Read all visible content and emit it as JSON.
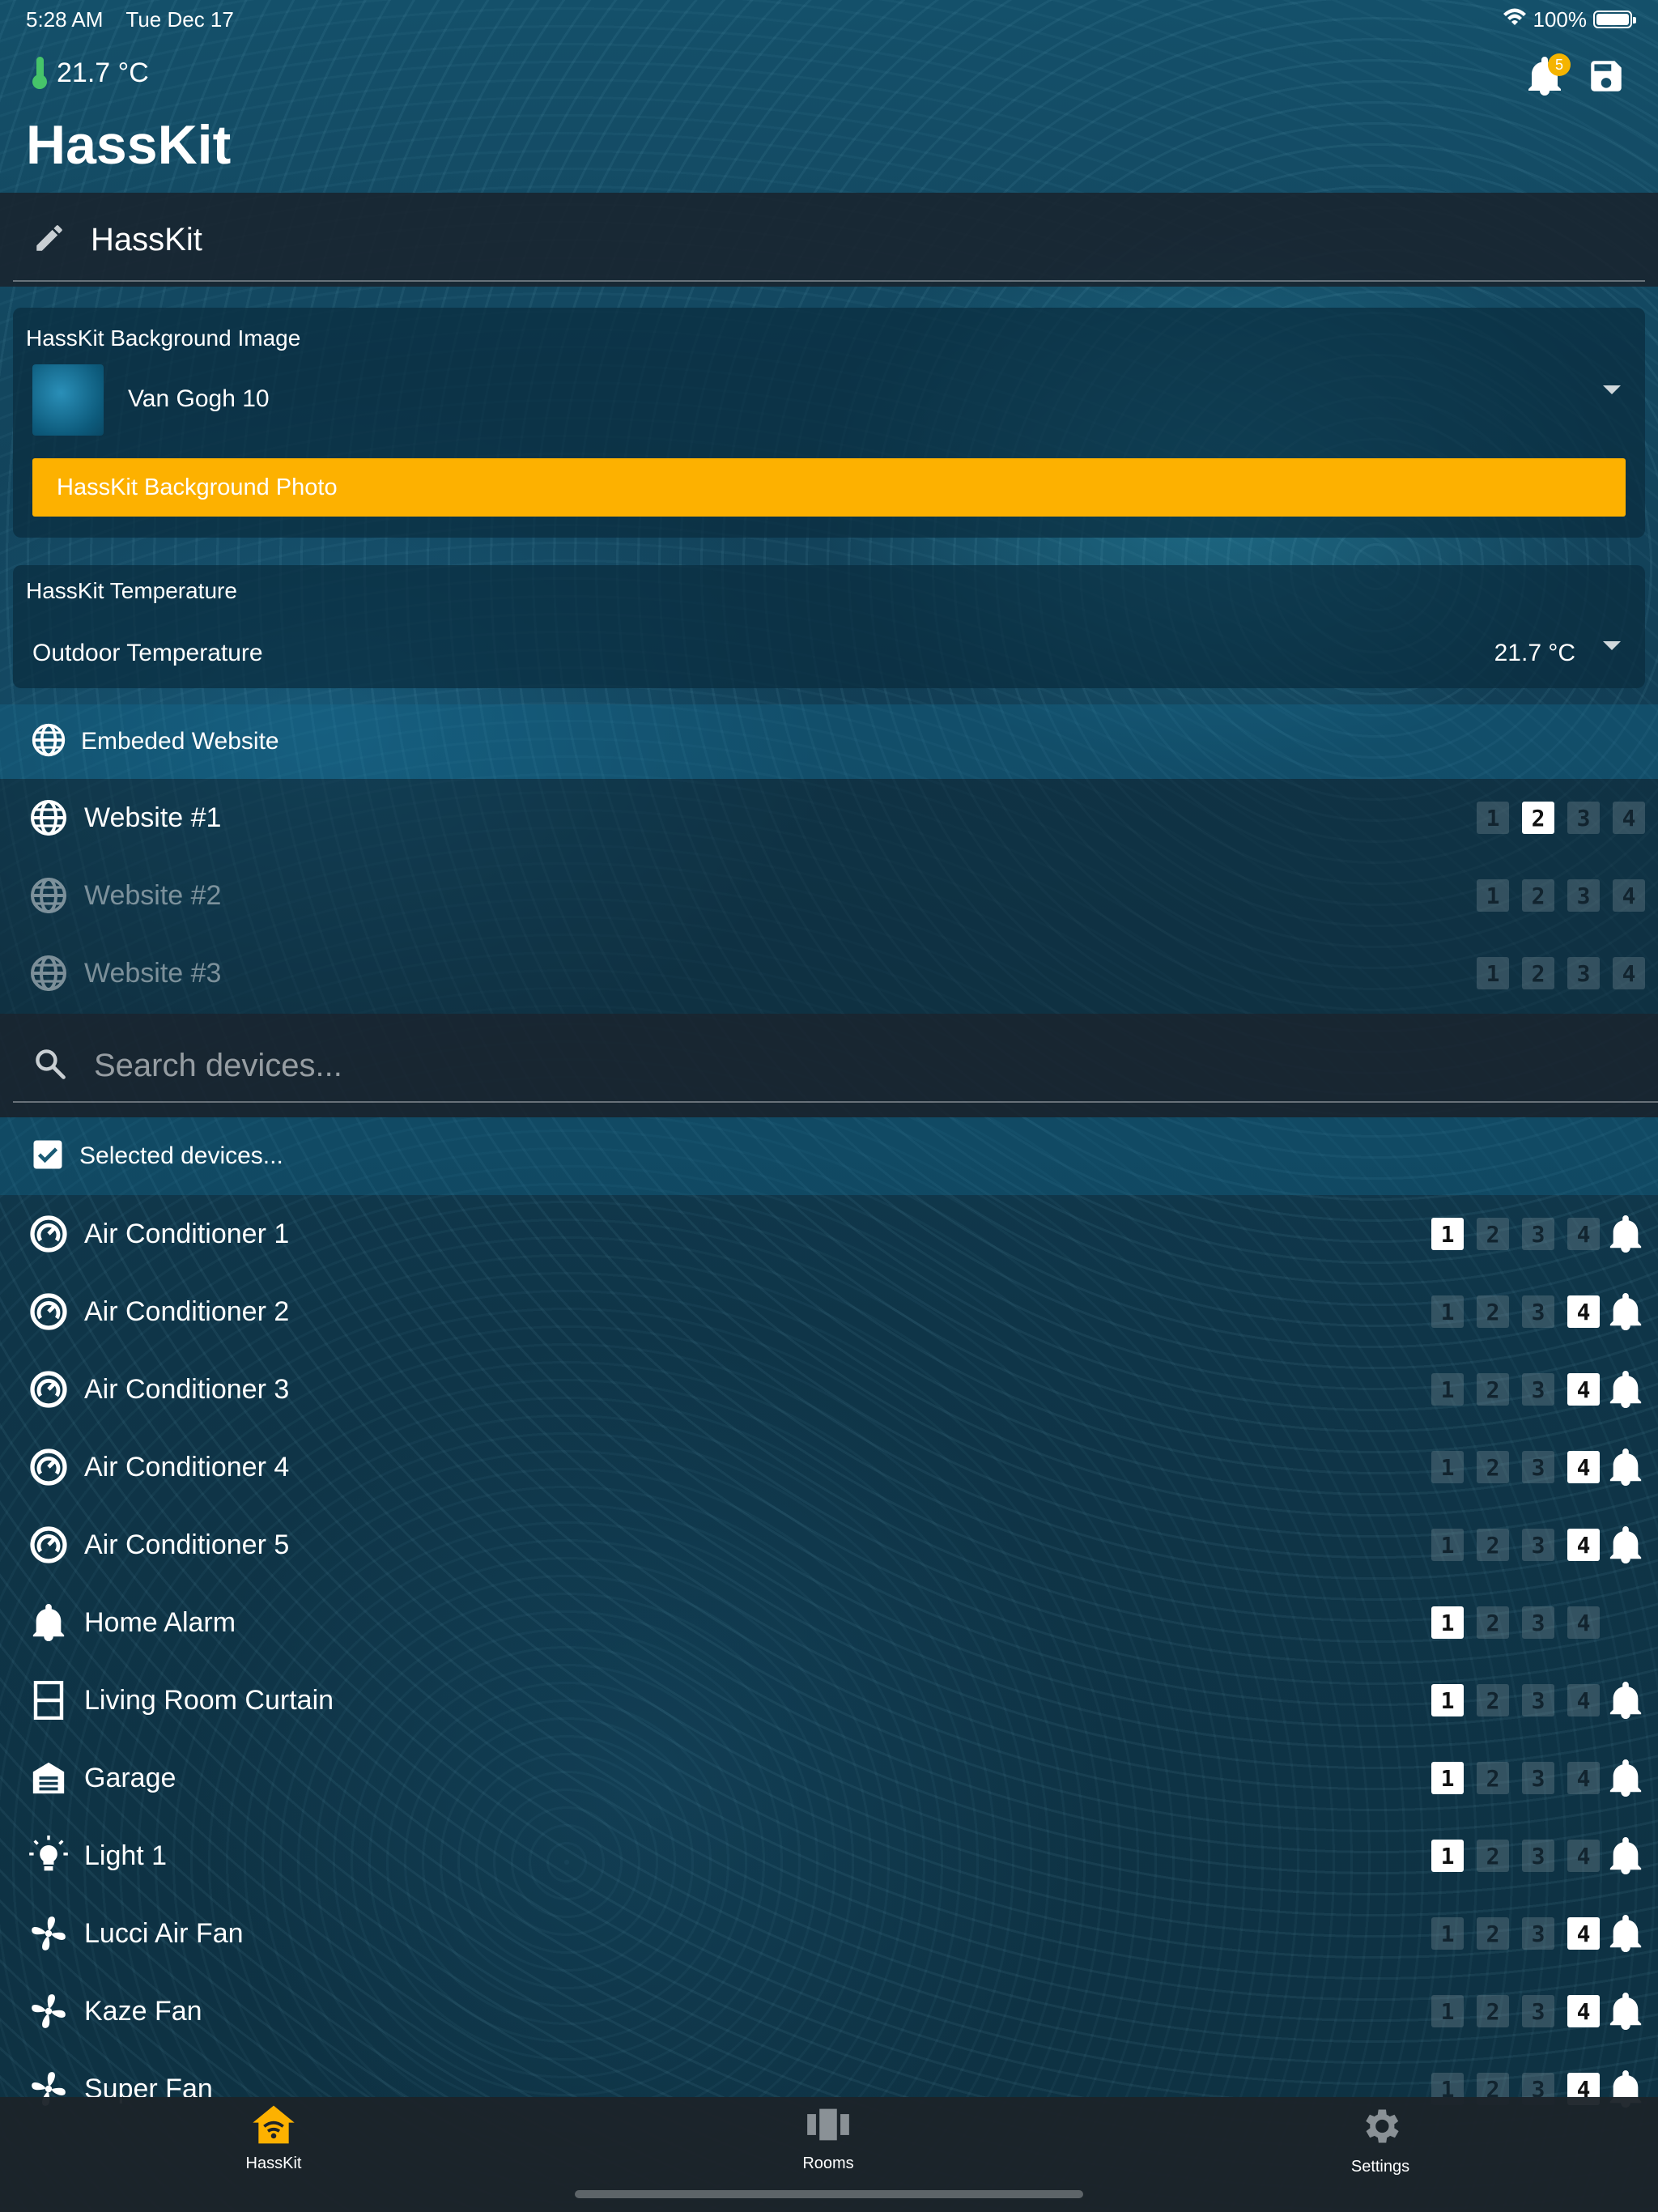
{
  "status_bar": {
    "time": "5:28 AM",
    "date": "Tue Dec 17",
    "battery": "100%"
  },
  "header": {
    "temperature": "21.7 °C",
    "notification_count": "5",
    "title": "HassKit"
  },
  "section": {
    "title": "HassKit"
  },
  "background_card": {
    "label": "HassKit Background Image",
    "selected": "Van Gogh 10",
    "photo_button": "HassKit Background Photo"
  },
  "temperature_card": {
    "label": "HassKit Temperature",
    "source": "Outdoor Temperature",
    "value": "21.7 °C"
  },
  "embedded": {
    "header": "Embeded Website",
    "websites": [
      {
        "label": "Website #1",
        "active": 2,
        "enabled": true
      },
      {
        "label": "Website #2",
        "active": 0,
        "enabled": false
      },
      {
        "label": "Website #3",
        "active": 0,
        "enabled": false
      }
    ]
  },
  "search": {
    "placeholder": "Search devices..."
  },
  "selected_header": "Selected devices...",
  "slot_labels": [
    "1",
    "2",
    "3",
    "4"
  ],
  "devices": [
    {
      "label": "Air Conditioner 1",
      "icon": "air-conditioner-icon",
      "active": 1,
      "bell": true
    },
    {
      "label": "Air Conditioner 2",
      "icon": "air-conditioner-icon",
      "active": 4,
      "bell": true
    },
    {
      "label": "Air Conditioner 3",
      "icon": "air-conditioner-icon",
      "active": 4,
      "bell": true
    },
    {
      "label": "Air Conditioner 4",
      "icon": "air-conditioner-icon",
      "active": 4,
      "bell": true
    },
    {
      "label": "Air Conditioner 5",
      "icon": "air-conditioner-icon",
      "active": 4,
      "bell": true
    },
    {
      "label": "Home Alarm",
      "icon": "bell-icon",
      "active": 1,
      "bell": false
    },
    {
      "label": "Living Room Curtain",
      "icon": "curtain-icon",
      "active": 1,
      "bell": true
    },
    {
      "label": "Garage",
      "icon": "garage-icon",
      "active": 1,
      "bell": true
    },
    {
      "label": "Light 1",
      "icon": "lightbulb-icon",
      "active": 1,
      "bell": true
    },
    {
      "label": "Lucci Air Fan",
      "icon": "fan-icon",
      "active": 4,
      "bell": true
    },
    {
      "label": "Kaze Fan",
      "icon": "fan-icon",
      "active": 4,
      "bell": true
    },
    {
      "label": "Super Fan",
      "icon": "fan-icon",
      "active": 4,
      "bell": true
    }
  ],
  "bottom_nav": {
    "items": [
      {
        "label": "HassKit",
        "icon": "home-wifi-icon",
        "active": true
      },
      {
        "label": "Rooms",
        "icon": "rooms-icon",
        "active": false
      },
      {
        "label": "Settings",
        "icon": "gear-icon",
        "active": false
      }
    ],
    "active_color": "#fdb100"
  },
  "colors": {
    "accent": "#fdb100",
    "thermometer": "#46c46a"
  }
}
